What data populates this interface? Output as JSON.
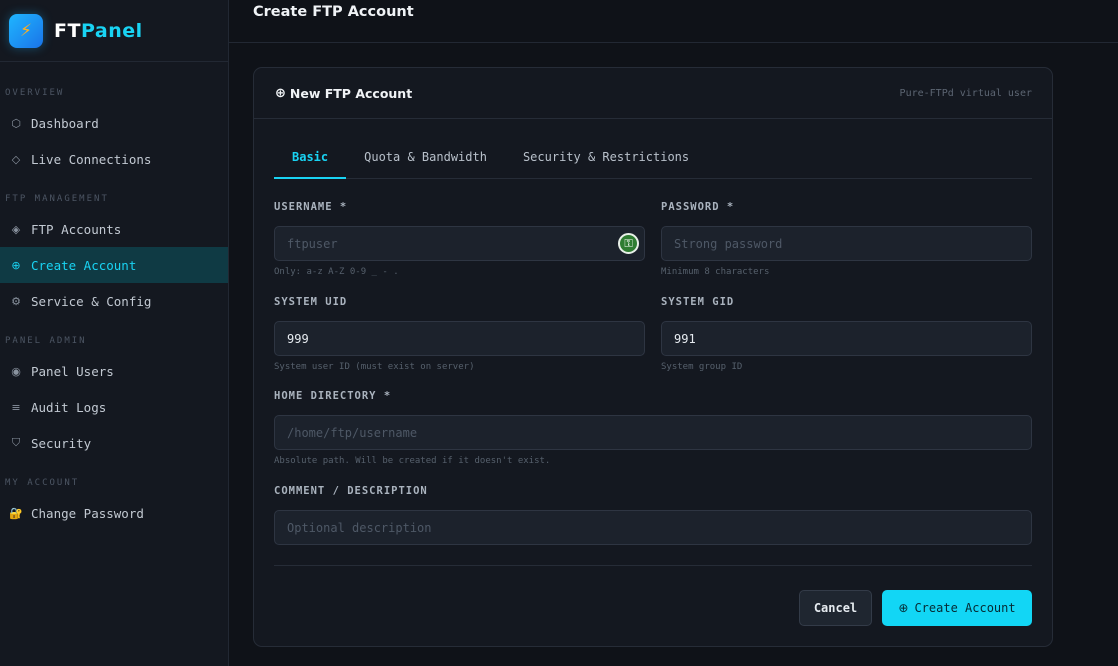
{
  "brand": {
    "logo_glyph": "⚡",
    "name_part1": "FT",
    "name_part2": "Panel"
  },
  "sidebar": {
    "sections": [
      {
        "title": "OVERVIEW",
        "items": [
          {
            "icon": "⬡",
            "label": "Dashboard"
          },
          {
            "icon": "◇",
            "label": "Live Connections"
          }
        ]
      },
      {
        "title": "FTP MANAGEMENT",
        "items": [
          {
            "icon": "◈",
            "label": "FTP Accounts"
          },
          {
            "icon": "⊕",
            "label": "Create Account",
            "active": true
          },
          {
            "icon": "⚙",
            "label": "Service & Config"
          }
        ]
      },
      {
        "title": "PANEL ADMIN",
        "items": [
          {
            "icon": "◉",
            "label": "Panel Users"
          },
          {
            "icon": "≡",
            "label": "Audit Logs"
          },
          {
            "icon": "⛉",
            "label": "Security"
          }
        ]
      },
      {
        "title": "MY ACCOUNT",
        "items": [
          {
            "icon": "🔐",
            "label": "Change Password"
          }
        ]
      }
    ]
  },
  "header": {
    "title": "Create FTP Account"
  },
  "card": {
    "title_icon": "⊕",
    "title": "New FTP Account",
    "subtitle": "Pure-FTPd virtual user"
  },
  "tabs": [
    {
      "label": "Basic",
      "active": true
    },
    {
      "label": "Quota & Bandwidth"
    },
    {
      "label": "Security & Restrictions"
    }
  ],
  "form": {
    "username": {
      "label": "USERNAME *",
      "placeholder": "ftpuser",
      "help": "Only: a-z A-Z 0-9 _ - ."
    },
    "password": {
      "label": "PASSWORD *",
      "placeholder": "Strong password",
      "help": "Minimum 8 characters"
    },
    "uid": {
      "label": "SYSTEM UID",
      "value": "999",
      "help": "System user ID (must exist on server)"
    },
    "gid": {
      "label": "SYSTEM GID",
      "value": "991",
      "help": "System group ID"
    },
    "home": {
      "label": "HOME DIRECTORY *",
      "placeholder": "/home/ftp/username",
      "help": "Absolute path. Will be created if it doesn't exist."
    },
    "comment": {
      "label": "COMMENT / DESCRIPTION",
      "placeholder": "Optional description"
    }
  },
  "buttons": {
    "cancel": "Cancel",
    "create_icon": "⊕",
    "create": "Create Account"
  },
  "colors": {
    "accent": "#19d3f3",
    "bg": "#0f1218",
    "panel": "#141820"
  }
}
